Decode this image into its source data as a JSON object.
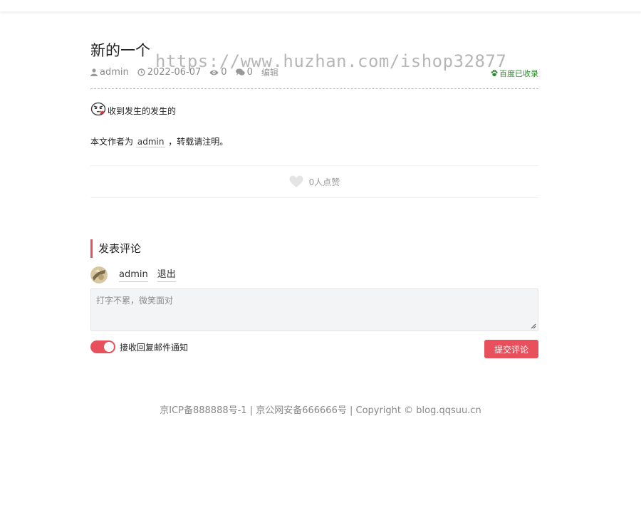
{
  "article": {
    "title": "新的一个",
    "author": "admin",
    "date": "2022-06-07",
    "views": "0",
    "comments": "0",
    "edit_label": "编辑",
    "baidu_status": "百度已收录",
    "content": "收到发生的发生的",
    "credit_prefix": "本文作者为",
    "credit_author": "admin",
    "credit_suffix": "，转载请注明。"
  },
  "like": {
    "text": "0人点赞"
  },
  "watermark": "https://www.huzhan.com/ishop32877",
  "comment": {
    "section_title": "发表评论",
    "user": "admin",
    "logout": "退出",
    "placeholder": "打字不累，微笑面对",
    "notify_label": "接收回复邮件通知",
    "submit_label": "提交评论"
  },
  "footer": {
    "text": "京ICP备888888号-1 | 京公网安备666666号 | Copyright © blog.qqsuu.cn"
  },
  "colors": {
    "accent": "#e8505b",
    "baidu_green": "#2f8a2f"
  },
  "icons": [
    "user-icon",
    "clock-icon",
    "eye-icon",
    "comment-icon",
    "paw-icon",
    "heart-icon",
    "emoji-icon",
    "avatar"
  ]
}
